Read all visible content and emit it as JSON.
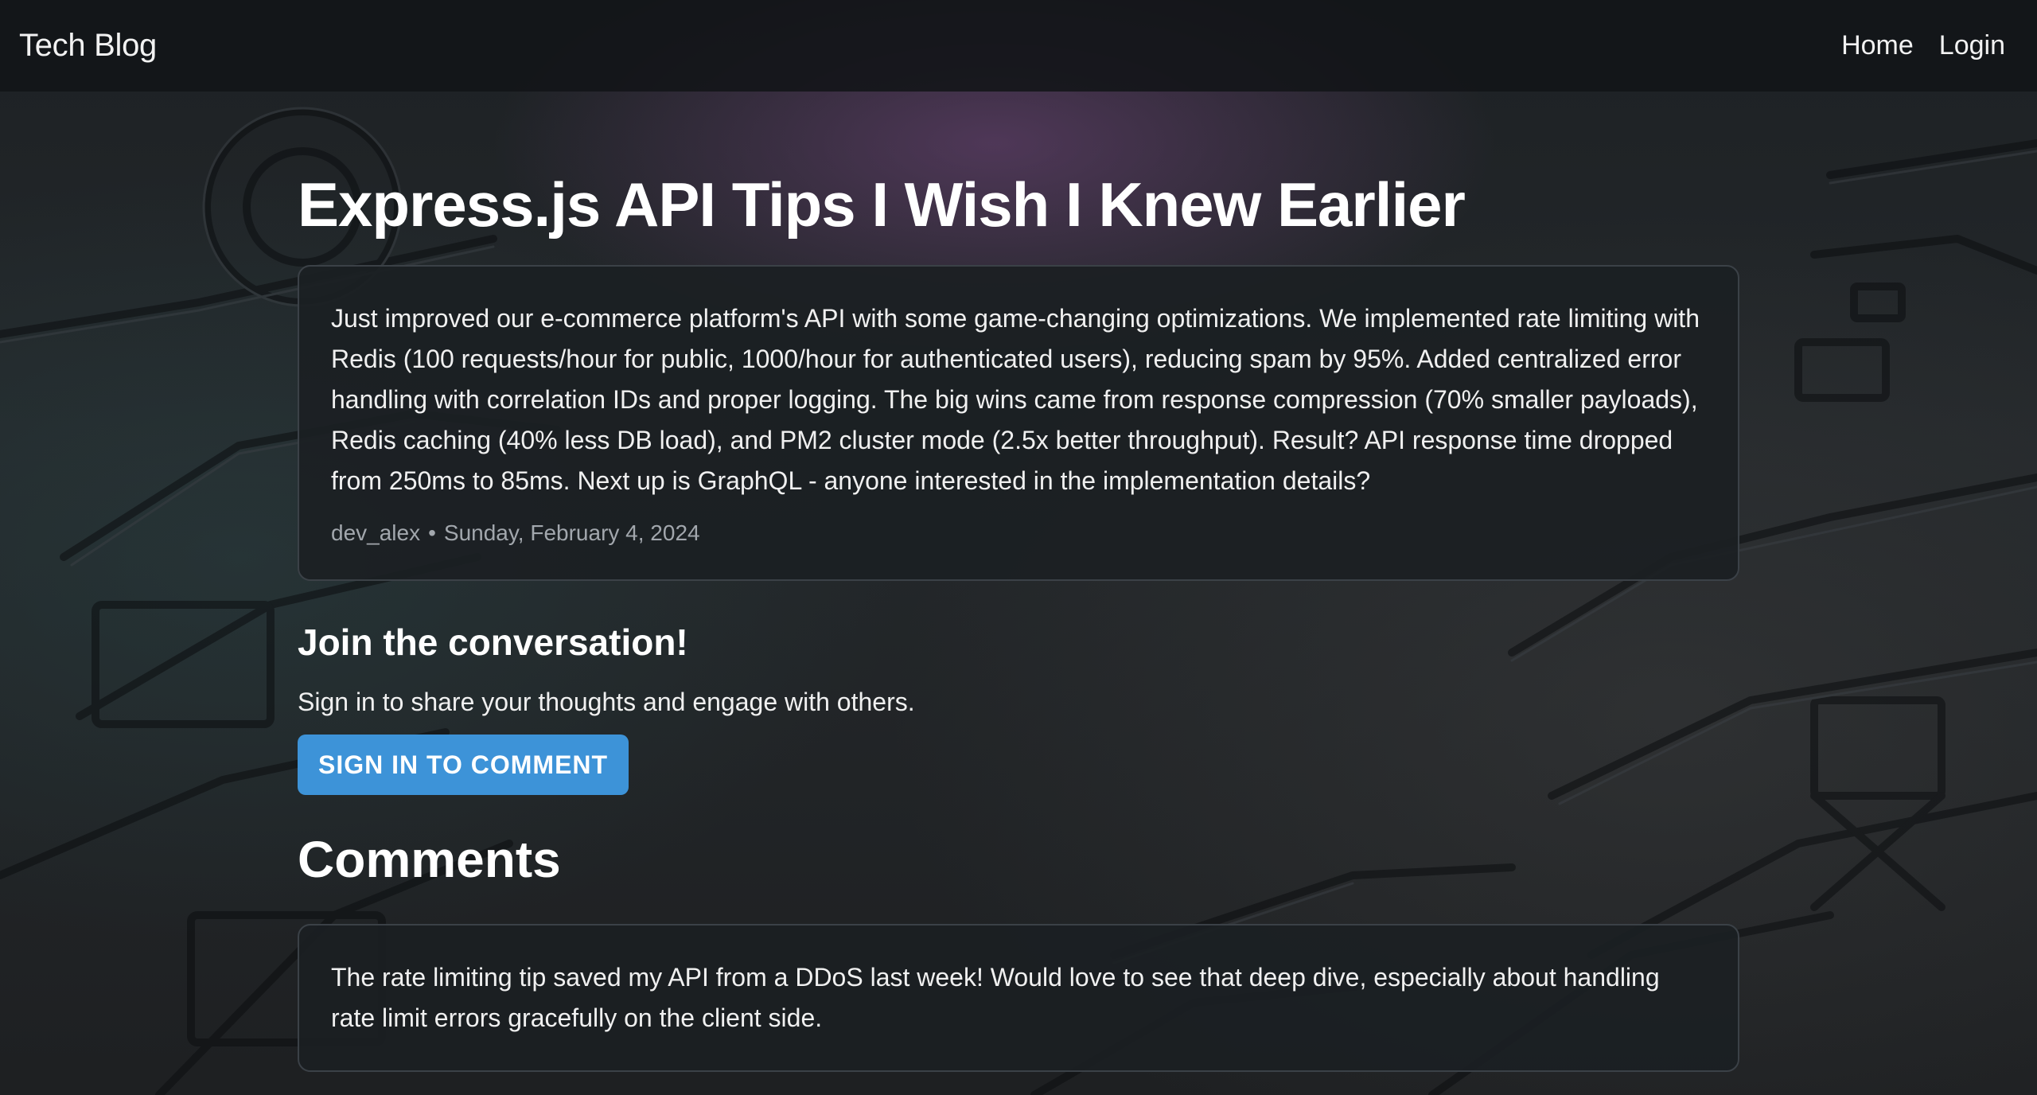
{
  "nav": {
    "brand": "Tech Blog",
    "links": [
      "Home",
      "Login"
    ]
  },
  "post": {
    "title": "Express.js API Tips I Wish I Knew Earlier",
    "body": "Just improved our e-commerce platform's API with some game-changing optimizations. We implemented rate limiting with Redis (100 requests/hour for public, 1000/hour for authenticated users), reducing spam by 95%. Added centralized error handling with correlation IDs and proper logging. The big wins came from response compression (70% smaller payloads), Redis caching (40% less DB load), and PM2 cluster mode (2.5x better throughput). Result? API response time dropped from 250ms to 85ms. Next up is GraphQL - anyone interested in the implementation details?",
    "author": "dev_alex",
    "separator": "•",
    "date": "Sunday, February 4, 2024"
  },
  "join": {
    "heading": "Join the conversation!",
    "text": "Sign in to share your thoughts and engage with others.",
    "button_label": "SIGN IN TO COMMENT"
  },
  "comments": {
    "heading": "Comments",
    "items": [
      {
        "body": "The rate limiting tip saved my API from a DDoS last week! Would love to see that deep dive, especially about handling rate limit errors gracefully on the client side."
      }
    ]
  },
  "colors": {
    "accent": "#3d93d8",
    "navbar_bg": "#121518",
    "card_bg": "#1b1f23",
    "card_border": "#3b4147",
    "meta_text": "#a2a7ad"
  }
}
